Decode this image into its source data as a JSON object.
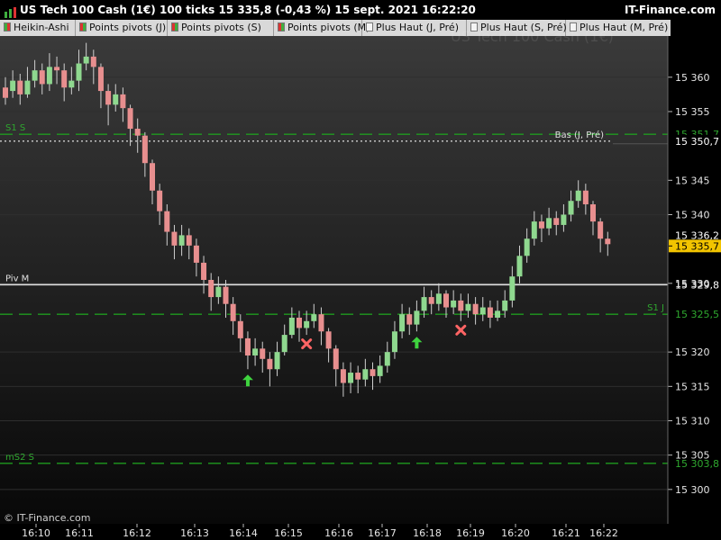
{
  "title": "US Tech 100 Cash (1€)  100 ticks 15 335,8 (-0,43 %) 15 sept. 2021 16:22:20",
  "brand": "IT-Finance.com",
  "copyright": "© IT-Finance.com",
  "watermark": "US Tech 100 Cash (1€)",
  "indicators": [
    {
      "label": "Heikin-Ashi",
      "colors": [
        "#3fae3f",
        "#d33"
      ]
    },
    {
      "label": "Points pivots (J)",
      "colors": [
        "#d33",
        "#3fae3f"
      ]
    },
    {
      "label": "Points pivots (S)",
      "colors": [
        "#d33",
        "#3fae3f"
      ]
    },
    {
      "label": "Points pivots (M)",
      "colors": [
        "#d33",
        "#3fae3f"
      ]
    },
    {
      "label": "Plus Haut (J, Pré)",
      "colors": [
        "#f4f4f4"
      ]
    },
    {
      "label": "Plus Haut (S, Pré)",
      "colors": [
        "#f4f4f4"
      ]
    },
    {
      "label": "Plus Haut (M, Pré)",
      "colors": [
        "#f4f4f4"
      ]
    }
  ],
  "chart_data": {
    "type": "candlestick",
    "y_ticks": [
      "15 360",
      "15 355",
      "15 345",
      "15 340",
      "15 330",
      "15 320",
      "15 315",
      "15 310",
      "15 305",
      "15 300"
    ],
    "y_tick_values": [
      15360,
      15355,
      15345,
      15340,
      15330,
      15320,
      15315,
      15310,
      15305,
      15300
    ],
    "x_ticks": [
      "16:10",
      "16:11",
      "16:12",
      "16:13",
      "16:14",
      "16:15",
      "16:16",
      "16:17",
      "16:18",
      "16:19",
      "16:20",
      "16:21",
      "16:22"
    ],
    "ylim": [
      15295,
      15366
    ],
    "levels": [
      {
        "label": "S1 S",
        "value": 15351.7,
        "tag": "15 351,7",
        "color": "#1f9a1f",
        "style": "dash"
      },
      {
        "label": "Bas (J, Pré)",
        "value": 15350.7,
        "tag": "15 350,7",
        "color": "#cfcfcf",
        "style": "dot"
      },
      {
        "label": "Piv M",
        "value": 15329.8,
        "tag": "15 329,8",
        "color": "#e0e0e0",
        "style": "solid"
      },
      {
        "label": "S1 J",
        "value": 15325.5,
        "tag": "15 325,5",
        "color": "#1f9a1f",
        "style": "dash"
      },
      {
        "label": "mS2 S",
        "value": 15303.8,
        "tag": "15 303,8",
        "color": "#1f9a1f",
        "style": "dash"
      }
    ],
    "price_tags": [
      {
        "value": 15336.2,
        "tag": "15 336,2",
        "style": "plain"
      },
      {
        "value": 15335.7,
        "tag": "15 335,7",
        "style": "current"
      }
    ],
    "candles": [
      [
        15358.5,
        15357,
        15360,
        15356
      ],
      [
        15358,
        15359.5,
        15361,
        15357
      ],
      [
        15359.5,
        15357.5,
        15360.5,
        15356
      ],
      [
        15357.5,
        15359.5,
        15361.5,
        15357
      ],
      [
        15359.5,
        15361,
        15362.5,
        15358.5
      ],
      [
        15361,
        15359,
        15362,
        15357.5
      ],
      [
        15359,
        15361.5,
        15363.5,
        15358
      ],
      [
        15361.5,
        15361,
        15363,
        15359
      ],
      [
        15361,
        15358.5,
        15362,
        15356.5
      ],
      [
        15358.5,
        15359.5,
        15361.5,
        15357.5
      ],
      [
        15359.5,
        15362,
        15364,
        15358
      ],
      [
        15362,
        15363,
        15365,
        15361
      ],
      [
        15363,
        15361.5,
        15364,
        15359
      ],
      [
        15361.5,
        15358,
        15362,
        15355.5
      ],
      [
        15358,
        15356,
        15359,
        15353
      ],
      [
        15356,
        15357.5,
        15359,
        15355
      ],
      [
        15357.5,
        15355.5,
        15358.5,
        15353.5
      ],
      [
        15355.5,
        15352.5,
        15356,
        15350
      ],
      [
        15352.5,
        15351.5,
        15354,
        15349
      ],
      [
        15351.5,
        15347.5,
        15352,
        15345.5
      ],
      [
        15347.5,
        15343.5,
        15348,
        15341.5
      ],
      [
        15343.5,
        15340.5,
        15344.5,
        15338.5
      ],
      [
        15340.5,
        15337.5,
        15341.5,
        15335.5
      ],
      [
        15337.5,
        15335.5,
        15338.5,
        15333.5
      ],
      [
        15335.5,
        15337,
        15338.5,
        15334
      ],
      [
        15337,
        15335.5,
        15338,
        15333.5
      ],
      [
        15335.5,
        15333,
        15336.5,
        15331
      ],
      [
        15333,
        15330.5,
        15334,
        15328.5
      ],
      [
        15330.5,
        15328,
        15331.5,
        15326
      ],
      [
        15328,
        15329.5,
        15331,
        15327
      ],
      [
        15329.5,
        15327,
        15330.5,
        15325
      ],
      [
        15327,
        15324.5,
        15328,
        15322.5
      ],
      [
        15324.5,
        15322,
        15325.5,
        15320
      ],
      [
        15322,
        15319.5,
        15323,
        15317.5
      ],
      [
        15319.5,
        15320.5,
        15322,
        15318
      ],
      [
        15320.5,
        15319,
        15321.5,
        15317
      ],
      [
        15319,
        15317.5,
        15320,
        15315
      ],
      [
        15317.5,
        15320,
        15321.5,
        15316.5
      ],
      [
        15320,
        15322.5,
        15324,
        15319.5
      ],
      [
        15322.5,
        15325,
        15326.5,
        15322
      ],
      [
        15325,
        15323.5,
        15326,
        15321.5
      ],
      [
        15323.5,
        15324.5,
        15326,
        15322.5
      ],
      [
        15324.5,
        15325.5,
        15327,
        15323.5
      ],
      [
        15325.5,
        15323,
        15326.5,
        15321
      ],
      [
        15323,
        15320.5,
        15323.5,
        15318.5
      ],
      [
        15320.5,
        15317.5,
        15321,
        15315
      ],
      [
        15317.5,
        15315.5,
        15318.5,
        15313.5
      ],
      [
        15315.5,
        15317,
        15318.5,
        15314
      ],
      [
        15317,
        15316,
        15318,
        15314
      ],
      [
        15316,
        15317.5,
        15319,
        15315
      ],
      [
        15317.5,
        15316.5,
        15318.5,
        15314.5
      ],
      [
        15316.5,
        15318,
        15319.5,
        15315.5
      ],
      [
        15318,
        15320,
        15321.5,
        15317
      ],
      [
        15320,
        15323,
        15324.5,
        15319
      ],
      [
        15323,
        15325.5,
        15327,
        15322
      ],
      [
        15325.5,
        15324,
        15326.5,
        15322.5
      ],
      [
        15324,
        15326,
        15327.5,
        15323
      ],
      [
        15326,
        15328,
        15329.5,
        15325
      ],
      [
        15328,
        15327,
        15329,
        15325.5
      ],
      [
        15327,
        15328.5,
        15330,
        15326
      ],
      [
        15328.5,
        15326.5,
        15329,
        15325
      ],
      [
        15326.5,
        15327.5,
        15329,
        15325.5
      ],
      [
        15327.5,
        15326,
        15328.5,
        15324.5
      ],
      [
        15326,
        15327,
        15328.5,
        15325
      ],
      [
        15327,
        15325.5,
        15328,
        15324
      ],
      [
        15325.5,
        15326.5,
        15328,
        15324.5
      ],
      [
        15326.5,
        15325,
        15327.5,
        15323.5
      ],
      [
        15325,
        15326,
        15327.5,
        15324.5
      ],
      [
        15326,
        15327.5,
        15329,
        15325
      ],
      [
        15327.5,
        15331,
        15332.5,
        15326.5
      ],
      [
        15331,
        15334,
        15335.5,
        15330
      ],
      [
        15334,
        15336.5,
        15338,
        15333
      ],
      [
        15336.5,
        15339,
        15340.5,
        15335.5
      ],
      [
        15339,
        15338,
        15340,
        15336
      ],
      [
        15338,
        15339.5,
        15341,
        15337
      ],
      [
        15339.5,
        15338.5,
        15340.5,
        15337
      ],
      [
        15338.5,
        15340,
        15341.5,
        15337.5
      ],
      [
        15340,
        15342,
        15343.5,
        15339
      ],
      [
        15342,
        15343.5,
        15345,
        15341
      ],
      [
        15343.5,
        15341.5,
        15344.5,
        15340
      ],
      [
        15341.5,
        15339,
        15342,
        15337
      ],
      [
        15339,
        15336.5,
        15339.5,
        15334.5
      ],
      [
        15336.5,
        15335.7,
        15337.5,
        15334
      ]
    ],
    "signals": [
      {
        "type": "buy",
        "index": 33
      },
      {
        "type": "sell",
        "index": 41
      },
      {
        "type": "buy",
        "index": 56
      },
      {
        "type": "sell",
        "index": 62
      }
    ]
  }
}
